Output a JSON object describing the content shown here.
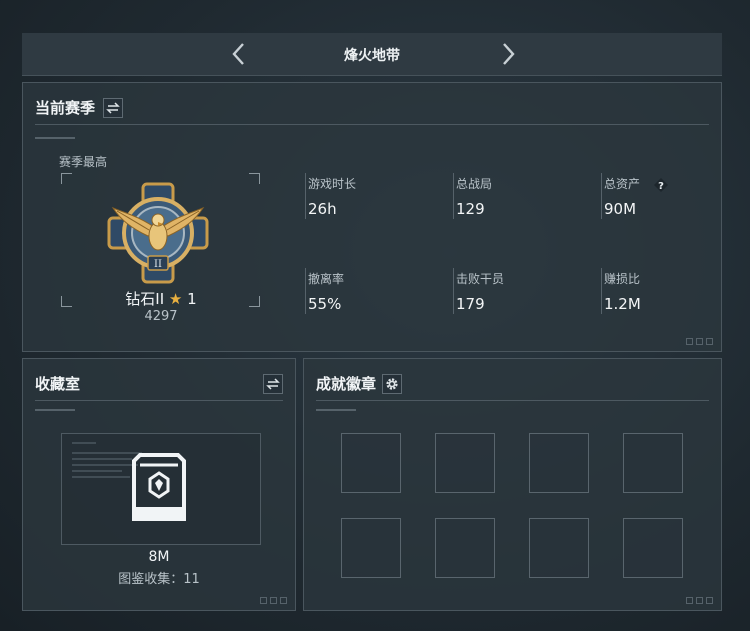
{
  "header": {
    "title": "烽火地带"
  },
  "season": {
    "title": "当前赛季",
    "best_label": "赛季最高",
    "rank_name": "钻石II",
    "rank_star_count": "1",
    "rank_score": "4297",
    "badge_numeral": "II",
    "stats": [
      {
        "label": "游戏时长",
        "value": "26h"
      },
      {
        "label": "总战局",
        "value": "129"
      },
      {
        "label": "总资产",
        "value": "90M"
      },
      {
        "label": "撤离率",
        "value": "55%"
      },
      {
        "label": "击败干员",
        "value": "179"
      },
      {
        "label": "赚损比",
        "value": "1.2M"
      }
    ]
  },
  "collection": {
    "title": "收藏室",
    "value": "8M",
    "count_text": "图鉴收集：11"
  },
  "achievements": {
    "title": "成就徽章",
    "slot_count": 8
  },
  "icons": {
    "prev": "chevron-left-icon",
    "next": "chevron-right-icon",
    "swap": "swap-icon",
    "settings": "gear-icon",
    "help": "question-icon",
    "star": "star-icon"
  },
  "colors": {
    "accent_gold": "#e8b040",
    "panel_bg": "#2c373e",
    "border": "#4a565e"
  }
}
